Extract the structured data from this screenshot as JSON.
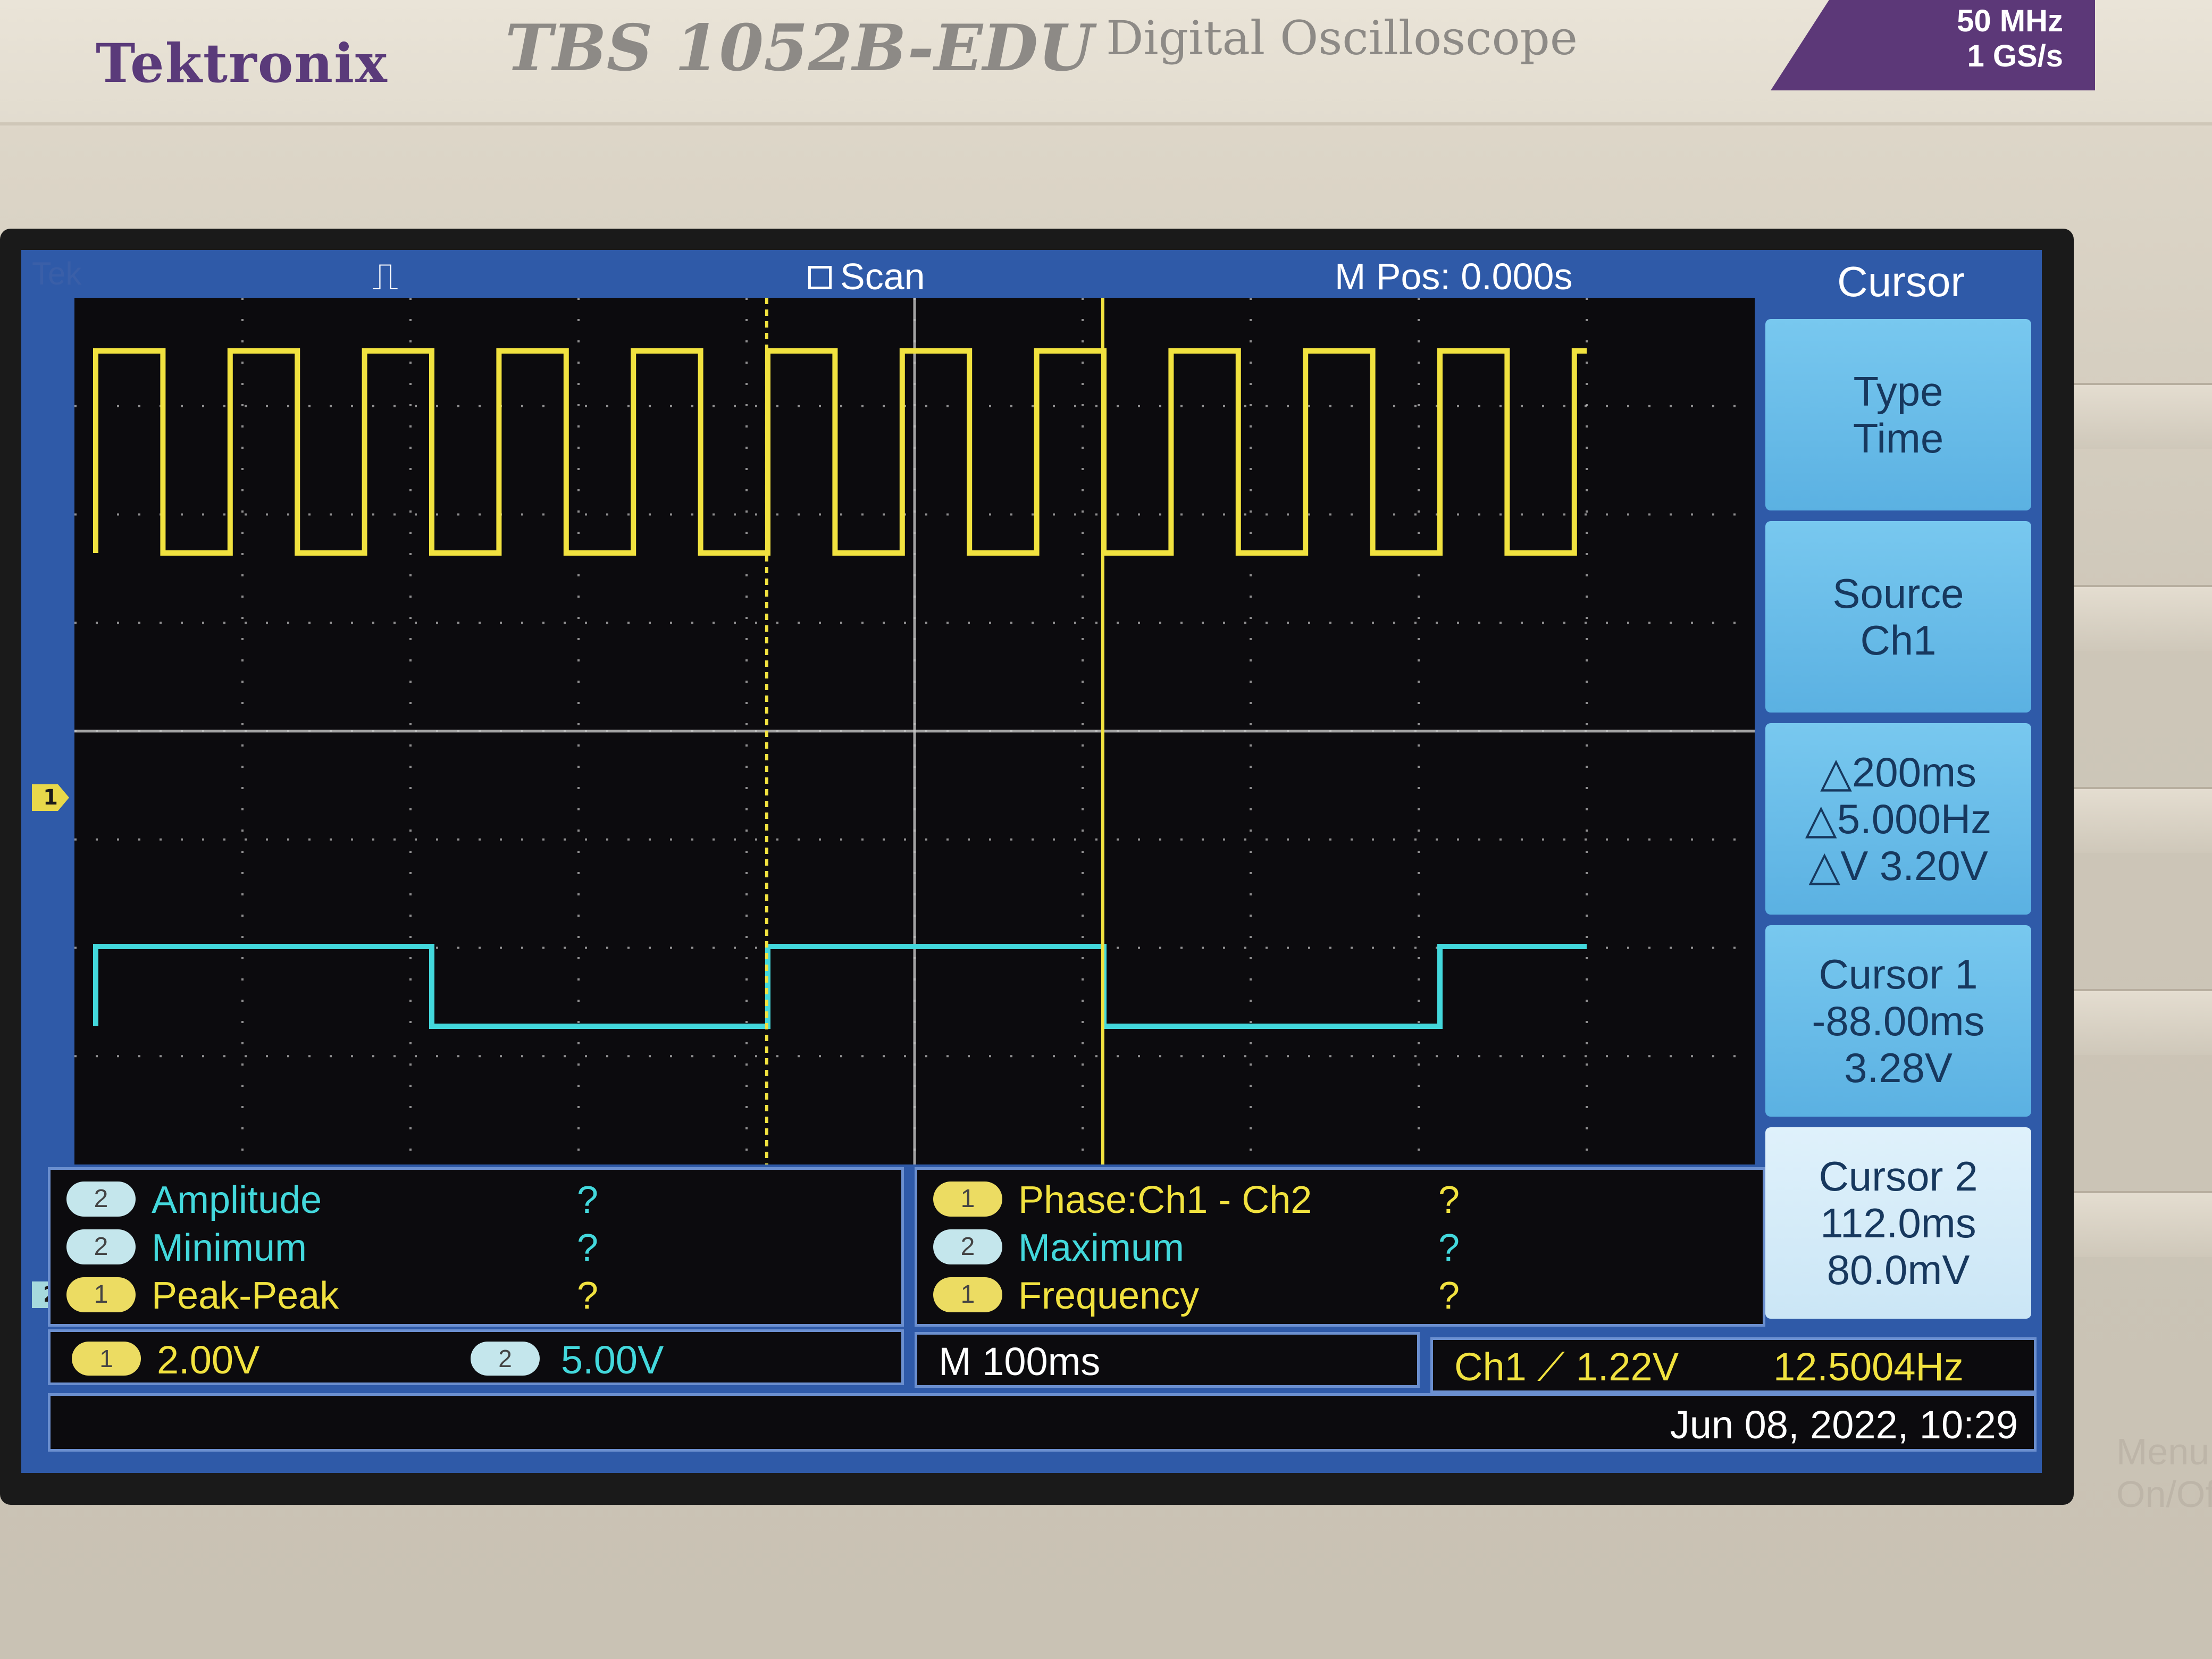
{
  "device": {
    "brand": "Tektronix",
    "model": "TBS 1052B-EDU",
    "description": "Digital Oscilloscope",
    "bandwidth": "50 MHz",
    "sample_rate": "1 GS/s"
  },
  "status": {
    "tek": "Tek",
    "trigger_icon": "⎍",
    "mode": "Scan",
    "mpos": "M Pos: 0.000s"
  },
  "markers": {
    "ch1": "1",
    "ch2": "2"
  },
  "menu": {
    "title": "Cursor",
    "type_label": "Type",
    "type_value": "Time",
    "source_label": "Source",
    "source_value": "Ch1",
    "delta_t": "△200ms",
    "delta_f": "△5.000Hz",
    "delta_v": "△V 3.20V",
    "cursor1_label": "Cursor 1",
    "cursor1_time": "-88.00ms",
    "cursor1_volt": "3.28V",
    "cursor2_label": "Cursor 2",
    "cursor2_time": "112.0ms",
    "cursor2_volt": "80.0mV"
  },
  "measurements": {
    "left": [
      {
        "ch": "2",
        "name": "Amplitude",
        "value": "?"
      },
      {
        "ch": "2",
        "name": "Minimum",
        "value": "?"
      },
      {
        "ch": "1",
        "name": "Peak-Peak",
        "value": "?"
      }
    ],
    "right": [
      {
        "ch": "1",
        "name": "Phase:Ch1 - Ch2",
        "value": "?"
      },
      {
        "ch": "2",
        "name": "Maximum",
        "value": "?"
      },
      {
        "ch": "1",
        "name": "Frequency",
        "value": "?"
      }
    ]
  },
  "bottom": {
    "ch1_chip": "1",
    "ch1_scale": "2.00V",
    "ch2_chip": "2",
    "ch2_scale": "5.00V",
    "timebase": "M 100ms",
    "trigger": "Ch1 ⟋ 1.22V",
    "trigger_freq": "12.5004Hz",
    "datetime": "Jun 08, 2022, 10:29"
  },
  "bezel": {
    "menu_onoff": "Menu On/Off"
  },
  "colors": {
    "ch1": "#f1e23f",
    "ch2": "#43d8dc",
    "panel": "#2f5aa8",
    "grid": "#c8c8c8"
  },
  "waveform": {
    "ch1_frequency_hz": 12.5,
    "ch1_duty": 0.5,
    "ch2_frequency_hz": 2.5,
    "cursor1_ms": -88,
    "cursor2_ms": 112,
    "time_div_ms": 100
  }
}
